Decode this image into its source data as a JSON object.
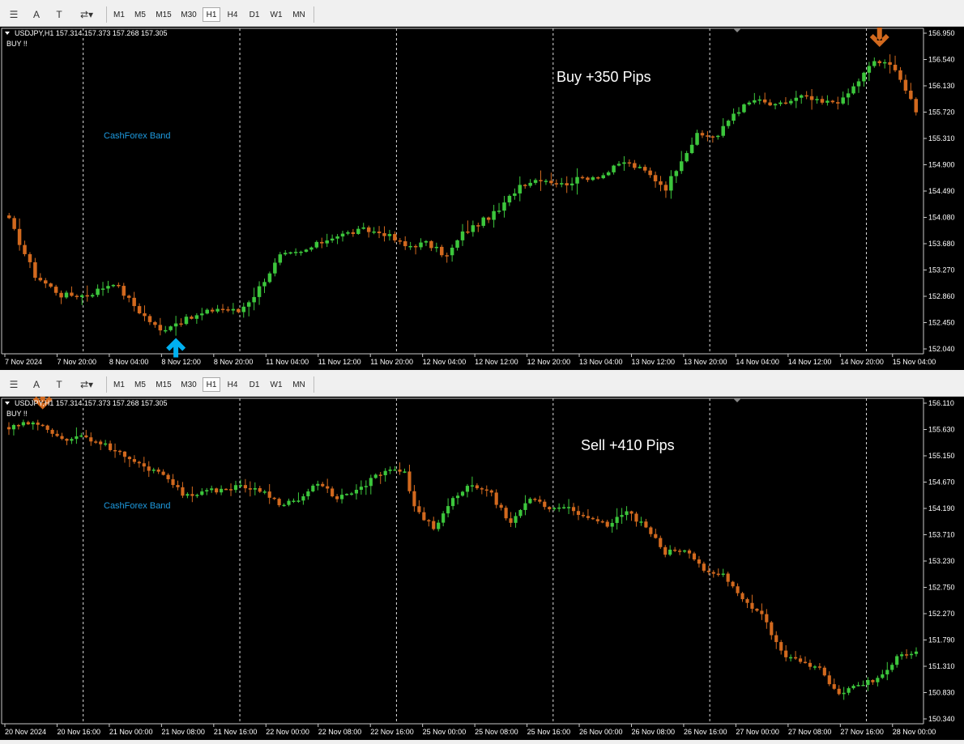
{
  "toolbar": {
    "tools": [
      {
        "name": "text-tool-icon",
        "label": "A"
      },
      {
        "name": "text-label-tool-icon",
        "label": "T"
      },
      {
        "name": "arrows-tool-icon",
        "label": "⇄▾"
      }
    ],
    "timeframes": [
      "M1",
      "M5",
      "M15",
      "M30",
      "H1",
      "H4",
      "D1",
      "W1",
      "MN"
    ],
    "active": "H1"
  },
  "colors": {
    "bull": "#3cc63c",
    "bear": "#d2691e",
    "bg": "#000000",
    "buy_arrow": "#00b0f0",
    "sell_arrow": "#d2691e",
    "band_label": "#1e9be0",
    "annotation": "#ffffff"
  },
  "chart_data": [
    {
      "type": "candlestick",
      "header": "USDJPY,H1  157.314 157.373 157.268 157.305",
      "signal": "BUY !!",
      "indicator_label": "CashForex Band",
      "annotation": "Buy +350 Pips",
      "yticks": [
        "156.950",
        "156.540",
        "156.130",
        "155.720",
        "155.310",
        "154.900",
        "154.490",
        "154.080",
        "153.680",
        "153.270",
        "152.860",
        "152.450",
        "152.040"
      ],
      "ylim": [
        152.0,
        157.0
      ],
      "xticks": [
        "7 Nov 2024",
        "7 Nov 20:00",
        "8 Nov 04:00",
        "8 Nov 12:00",
        "8 Nov 20:00",
        "11 Nov 04:00",
        "11 Nov 12:00",
        "11 Nov 20:00",
        "12 Nov 04:00",
        "12 Nov 12:00",
        "12 Nov 20:00",
        "13 Nov 04:00",
        "13 Nov 12:00",
        "13 Nov 20:00",
        "14 Nov 04:00",
        "14 Nov 12:00",
        "14 Nov 20:00",
        "15 Nov 04:00"
      ],
      "anchors": [
        [
          0,
          154.05
        ],
        [
          5,
          153.2
        ],
        [
          10,
          152.9
        ],
        [
          15,
          152.9
        ],
        [
          20,
          153.1
        ],
        [
          25,
          152.65
        ],
        [
          29,
          152.35
        ],
        [
          31,
          152.45
        ],
        [
          35,
          152.55
        ],
        [
          40,
          152.7
        ],
        [
          44,
          152.65
        ],
        [
          47,
          152.9
        ],
        [
          52,
          153.5
        ],
        [
          56,
          153.55
        ],
        [
          62,
          153.8
        ],
        [
          68,
          153.9
        ],
        [
          72,
          153.85
        ],
        [
          76,
          153.65
        ],
        [
          80,
          153.7
        ],
        [
          84,
          153.5
        ],
        [
          87,
          153.85
        ],
        [
          90,
          154.0
        ],
        [
          94,
          154.2
        ],
        [
          98,
          154.6
        ],
        [
          102,
          154.7
        ],
        [
          106,
          154.6
        ],
        [
          110,
          154.7
        ],
        [
          114,
          154.75
        ],
        [
          118,
          154.95
        ],
        [
          122,
          154.8
        ],
        [
          126,
          154.55
        ],
        [
          129,
          155.0
        ],
        [
          132,
          155.35
        ],
        [
          136,
          155.35
        ],
        [
          139,
          155.7
        ],
        [
          143,
          155.9
        ],
        [
          147,
          155.8
        ],
        [
          152,
          155.95
        ],
        [
          156,
          155.85
        ],
        [
          160,
          155.9
        ],
        [
          163,
          156.2
        ],
        [
          166,
          156.5
        ],
        [
          170,
          156.4
        ],
        [
          174,
          155.7
        ]
      ],
      "buy_arrow_at": 32,
      "sell_arrow_at": 167
    },
    {
      "type": "candlestick",
      "header": "USDJPY,H1  157.314 157.373 157.268 157.305",
      "signal": "BUY !!",
      "indicator_label": "CashForex Band",
      "annotation": "Sell +410 Pips",
      "yticks": [
        "156.110",
        "155.630",
        "155.150",
        "154.670",
        "154.190",
        "153.710",
        "153.230",
        "152.750",
        "152.270",
        "151.790",
        "151.310",
        "150.830",
        "150.340"
      ],
      "ylim": [
        150.25,
        156.15
      ],
      "xticks": [
        "20 Nov 2024",
        "20 Nov 16:00",
        "21 Nov 00:00",
        "21 Nov 08:00",
        "21 Nov 16:00",
        "22 Nov 00:00",
        "22 Nov 08:00",
        "22 Nov 16:00",
        "25 Nov 00:00",
        "25 Nov 08:00",
        "25 Nov 16:00",
        "26 Nov 00:00",
        "26 Nov 08:00",
        "26 Nov 16:00",
        "27 Nov 00:00",
        "27 Nov 08:00",
        "27 Nov 16:00",
        "28 Nov 00:00"
      ],
      "anchors": [
        [
          0,
          155.6
        ],
        [
          4,
          155.7
        ],
        [
          8,
          155.6
        ],
        [
          12,
          155.4
        ],
        [
          16,
          155.45
        ],
        [
          20,
          155.3
        ],
        [
          24,
          155.1
        ],
        [
          28,
          154.9
        ],
        [
          32,
          154.8
        ],
        [
          36,
          154.4
        ],
        [
          40,
          154.45
        ],
        [
          44,
          154.5
        ],
        [
          48,
          154.55
        ],
        [
          52,
          154.5
        ],
        [
          56,
          154.25
        ],
        [
          60,
          154.3
        ],
        [
          64,
          154.6
        ],
        [
          68,
          154.35
        ],
        [
          72,
          154.45
        ],
        [
          76,
          154.75
        ],
        [
          80,
          154.85
        ],
        [
          82,
          154.8
        ],
        [
          84,
          154.15
        ],
        [
          88,
          153.8
        ],
        [
          92,
          154.3
        ],
        [
          96,
          154.6
        ],
        [
          100,
          154.4
        ],
        [
          104,
          153.85
        ],
        [
          108,
          154.35
        ],
        [
          112,
          154.15
        ],
        [
          116,
          154.2
        ],
        [
          120,
          153.95
        ],
        [
          124,
          153.85
        ],
        [
          128,
          154.1
        ],
        [
          132,
          153.8
        ],
        [
          136,
          153.35
        ],
        [
          140,
          153.4
        ],
        [
          144,
          153.05
        ],
        [
          148,
          152.95
        ],
        [
          152,
          152.5
        ],
        [
          156,
          152.25
        ],
        [
          160,
          151.55
        ],
        [
          164,
          151.35
        ],
        [
          168,
          151.25
        ],
        [
          172,
          150.75
        ],
        [
          176,
          150.95
        ],
        [
          180,
          151.05
        ],
        [
          184,
          151.45
        ],
        [
          188,
          151.55
        ]
      ],
      "sell_arrow_at": 7
    }
  ]
}
